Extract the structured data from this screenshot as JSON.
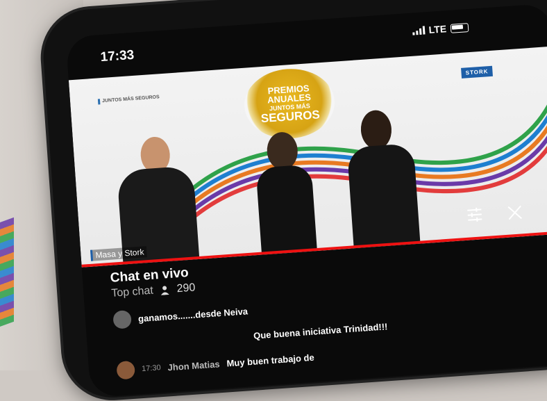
{
  "status": {
    "time": "17:33",
    "network": "LTE"
  },
  "video": {
    "event_logo_line1": "PREMIOS",
    "event_logo_line2": "ANUALES",
    "event_logo_line3": "JUNTOS MÁS",
    "event_logo_line4": "SEGUROS",
    "corner_logo_left": "JUNTOS MÁS SEGUROS",
    "corner_logo_right": "STORK",
    "channel_label": "Masa y Stork",
    "progress": 1.0,
    "colors": {
      "accent": "#e11111",
      "brand": "#1e5fa8",
      "gold": "#d6a314"
    }
  },
  "chat": {
    "title": "Chat en vivo",
    "mode": "Top chat",
    "viewer_count": "290",
    "messages": [
      {
        "time": "",
        "author": "",
        "text": "ganamos.......desde Neiva"
      },
      {
        "time": "",
        "author": "",
        "text": "Que buena iniciativa Trinidad!!!"
      },
      {
        "time": "17:30",
        "author": "Jhon Matias",
        "text": "Muy buen trabajo de"
      }
    ]
  },
  "icons": {
    "filter": "sliders-icon",
    "close": "close-icon",
    "viewers": "person-icon"
  }
}
